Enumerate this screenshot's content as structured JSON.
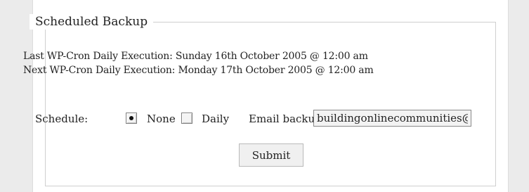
{
  "fieldset": {
    "legend": "Scheduled Backup"
  },
  "cron": {
    "last_label": "Last WP-Cron Daily Execution:",
    "last_value": "Sunday 16th October 2005 @ 12:00 am",
    "next_label": "Next WP-Cron Daily Execution:",
    "next_value": "Monday 17th October 2005 @ 12:00 am"
  },
  "schedule": {
    "label": "Schedule:",
    "options": [
      {
        "label": "None",
        "checked": true
      },
      {
        "label": "Daily",
        "checked": false
      }
    ],
    "selected": "None"
  },
  "email": {
    "label": "Email backup to:",
    "value": "buildingonlinecommunities@gmail.com"
  },
  "submit": {
    "label": "Submit"
  },
  "colors": {
    "page_background": "#ebebeb",
    "panel_background": "#ffffff",
    "fieldset_border": "#cfcfcf",
    "input_background": "#f3f3f3"
  }
}
